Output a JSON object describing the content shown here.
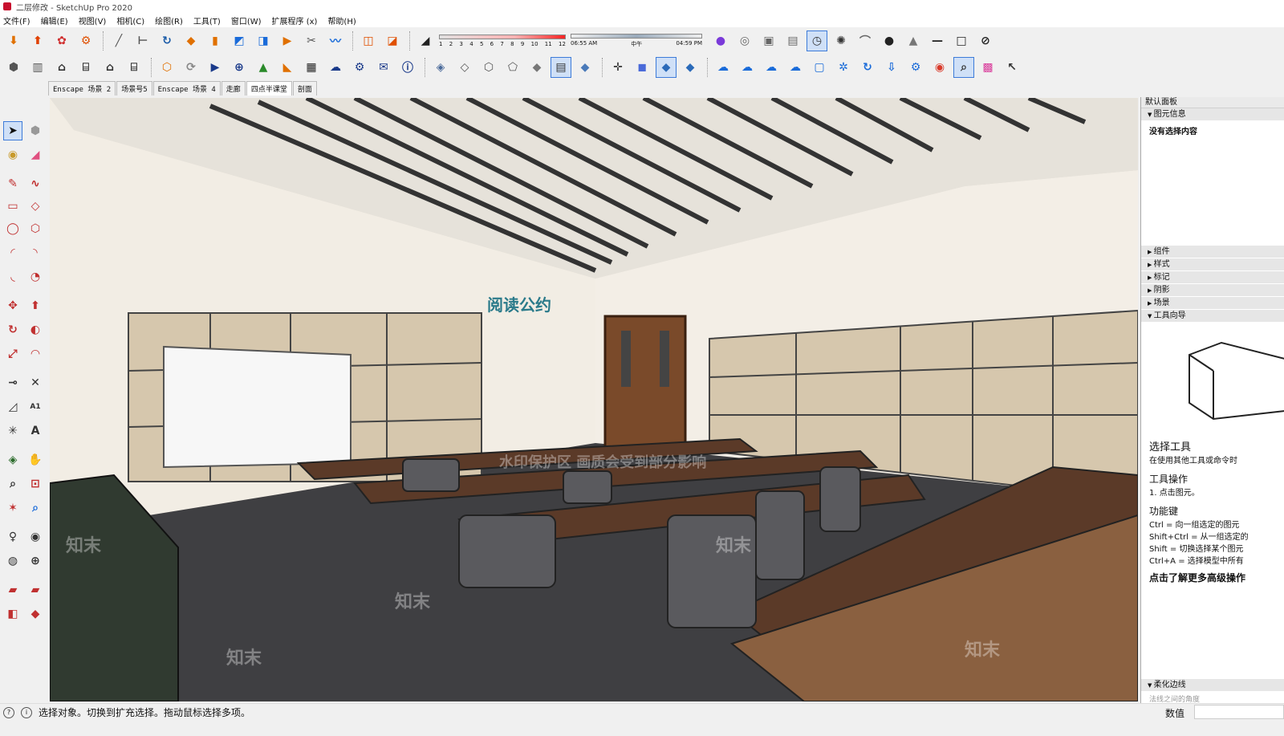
{
  "window": {
    "title": "二层修改 - SketchUp Pro 2020"
  },
  "menu": [
    "文件(F)",
    "编辑(E)",
    "视图(V)",
    "相机(C)",
    "绘图(R)",
    "工具(T)",
    "窗口(W)",
    "扩展程序 (x)",
    "帮助(H)"
  ],
  "shadow_widget": {
    "months": [
      "1",
      "2",
      "3",
      "4",
      "5",
      "6",
      "7",
      "8",
      "9",
      "10",
      "11",
      "12"
    ]
  },
  "time_widget": {
    "start": "06:55 AM",
    "mid": "中午",
    "end": "04:59 PM"
  },
  "scene_tabs": [
    "Enscape 场景 2",
    "场景号5",
    "Enscape 场景 4",
    "走廊",
    "四点半课堂",
    "剖面"
  ],
  "active_tab": 4,
  "right_panel": {
    "title": "默认面板",
    "entity_info": {
      "label": "图元信息",
      "value": "没有选择内容"
    },
    "sections": [
      "组件",
      "样式",
      "标记",
      "阴影",
      "场景",
      "工具向导"
    ],
    "instructor": {
      "tool_title": "选择工具",
      "tool_desc": "在使用其他工具或命令时",
      "op_title": "工具操作",
      "op_step": "1. 点击图元。",
      "func_title": "功能键",
      "func_lines": [
        "Ctrl = 向一组选定的图元",
        "Shift+Ctrl = 从一组选定的",
        "Shift = 切换选择某个图元",
        "Ctrl+A = 选择模型中所有"
      ],
      "more": "点击了解更多高级操作"
    },
    "soften": {
      "label": "柔化边线",
      "sub": "法线之间的角度"
    }
  },
  "status": {
    "message": "选择对象。切换到扩充选择。拖动鼠标选择多项。",
    "value_label": "数值"
  },
  "scene": {
    "wall_sign": "阅读公约",
    "watermark_banner": "水印保护区  画质会受到部分影响",
    "watermark_logo": "知末"
  }
}
